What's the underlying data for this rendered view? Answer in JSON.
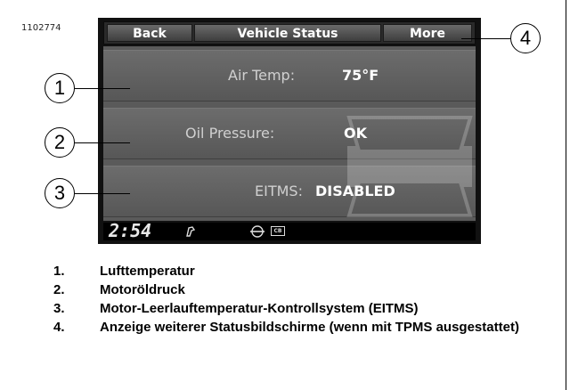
{
  "figure_id": "1102774",
  "screen": {
    "back_label": "Back",
    "title": "Vehicle Status",
    "more_label": "More",
    "rows": [
      {
        "label": "Air Temp:",
        "value": "75°F"
      },
      {
        "label": "Oil Pressure:",
        "value": "OK"
      },
      {
        "label": "EITMS:",
        "value": "DISABLED"
      }
    ],
    "status_bar": {
      "time": "2:54",
      "icons": [
        "fuel-nozzle-icon",
        "vehicle-symbol-icon",
        "cb-radio-icon"
      ],
      "cb_text": "CB"
    }
  },
  "callouts": [
    "1",
    "2",
    "3",
    "4"
  ],
  "legend": [
    {
      "num": "1.",
      "text": "Lufttemperatur"
    },
    {
      "num": "2.",
      "text": "Motoröldruck"
    },
    {
      "num": "3.",
      "text": "Motor-Leerlauftemperatur-Kontrollsystem (EITMS)"
    },
    {
      "num": "4.",
      "text": "Anzeige weiterer Statusbildschirme (wenn mit TPMS ausgestattet)"
    }
  ],
  "colors": {
    "screen_bg": "#5a5a5a",
    "bar": "#2a2a2a",
    "text_value": "#ffffff"
  }
}
